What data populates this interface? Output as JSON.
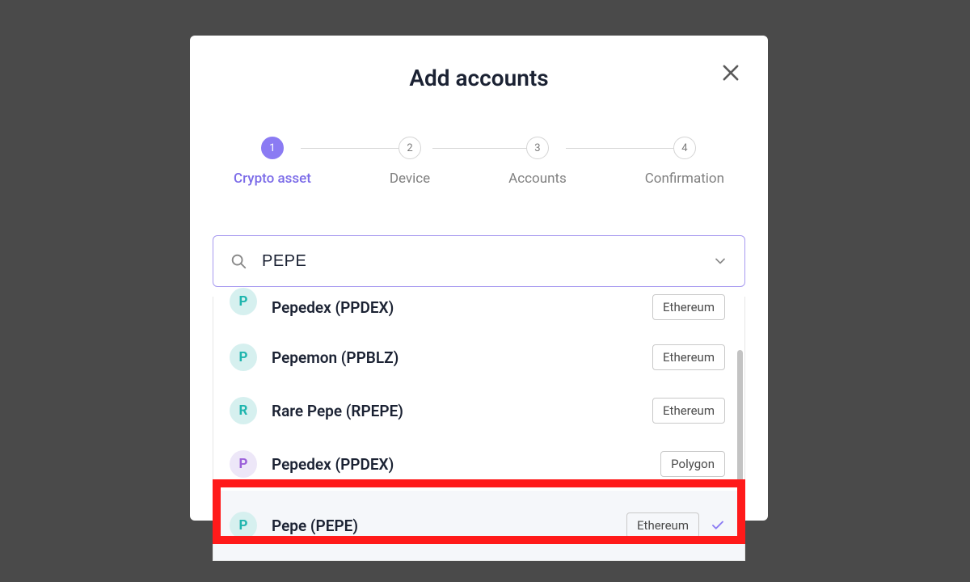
{
  "modal": {
    "title": "Add accounts"
  },
  "stepper": {
    "steps": [
      {
        "num": "1",
        "label": "Crypto asset",
        "active": true
      },
      {
        "num": "2",
        "label": "Device",
        "active": false
      },
      {
        "num": "3",
        "label": "Accounts",
        "active": false
      },
      {
        "num": "4",
        "label": "Confirmation",
        "active": false
      }
    ]
  },
  "search": {
    "value": "PEPE"
  },
  "options": [
    {
      "letter": "P",
      "color": "teal",
      "label": "Pepedex (PPDEX)",
      "chain": "Ethereum",
      "selected": false,
      "cut": true
    },
    {
      "letter": "P",
      "color": "teal",
      "label": "Pepemon (PPBLZ)",
      "chain": "Ethereum",
      "selected": false
    },
    {
      "letter": "R",
      "color": "teal",
      "label": "Rare Pepe (RPEPE)",
      "chain": "Ethereum",
      "selected": false
    },
    {
      "letter": "P",
      "color": "purple",
      "label": "Pepedex (PPDEX)",
      "chain": "Polygon",
      "selected": false
    },
    {
      "letter": "P",
      "color": "teal",
      "label": "Pepe (PEPE)",
      "chain": "Ethereum",
      "selected": true,
      "highlighted": true
    }
  ]
}
